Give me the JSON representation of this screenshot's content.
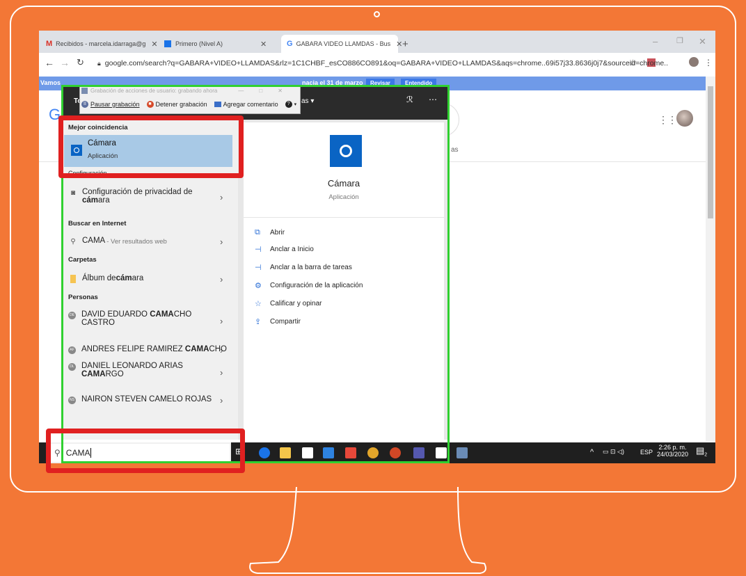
{
  "browser": {
    "tabs": [
      {
        "label": "Recibidos - marcela.idarraga@g",
        "icon": "gmail-icon",
        "color": "#d93025"
      },
      {
        "label": "Primero (Nivel A)",
        "icon": "classroom-icon",
        "color": "#1a73e8"
      },
      {
        "label": "GABARA VIDEO LLAMDAS - Bus",
        "icon": "google-icon",
        "color": "#4285f4"
      }
    ],
    "new_tab": "+",
    "url": "google.com/search?q=GABARA+VIDEO+LLAMDAS&rlz=1C1CHBF_esCO886CO891&oq=GABARA+VIDEO+LLAMDAS&aqs=chrome..69i57j33.8636j0j7&sourceid=chrome...",
    "infobar_left": "Vamos",
    "infobar_mid": "nacia el 31 de marzo",
    "infobar_btn1": "Revisar",
    "infobar_btn2": "Entendido",
    "google_right": "as",
    "google_left_glyph": "G"
  },
  "recorder": {
    "title": "Grabación de acciones de usuario: grabando ahora",
    "pause": "Pausar grabación",
    "stop": "Detener grabación",
    "comment": "Agregar comentario"
  },
  "start_menu": {
    "top_left": "To",
    "top_right": "as ▾",
    "sections": {
      "best_match": "Mejor coincidencia",
      "settings": "Configuración",
      "web": "Buscar en Internet",
      "folders": "Carpetas",
      "people": "Personas"
    },
    "best_match": {
      "name_plain": "Cám",
      "name_bold": "ara",
      "type": "Aplicación"
    },
    "settings_item": {
      "pre": "Configuración de privacidad de",
      "bold": "cám",
      "post": "ara"
    },
    "web_item": {
      "query": "CAMA",
      "suffix": " - Ver resultados web"
    },
    "folder_item": {
      "pre": "Álbum de ",
      "bold": "cám",
      "post": "ara"
    },
    "people": [
      {
        "initials": "DE",
        "pre": "DAVID EDUARDO ",
        "bold": "CAMA",
        "post": "CHO CASTRO"
      },
      {
        "initials": "AF",
        "pre": "ANDRES FELIPE RAMIREZ ",
        "bold": "CAMA",
        "post": "CHO"
      },
      {
        "initials": "DL",
        "pre": "DANIEL LEONARDO ARIAS ",
        "bold": "CAMA",
        "post": "RGO"
      },
      {
        "initials": "NS",
        "pre": "NAIRON STEVEN CAMELO ROJAS",
        "bold": "",
        "post": ""
      }
    ],
    "preview": {
      "name": "Cámara",
      "type": "Aplicación"
    },
    "actions": [
      "Abrir",
      "Anclar a Inicio",
      "Anclar a la barra de tareas",
      "Configuración de la aplicación",
      "Calificar y opinar",
      "Compartir"
    ],
    "search_value": "CAMA"
  },
  "taskbar": {
    "lang": "ESP",
    "time": "2:26 p. m.",
    "date": "24/03/2020",
    "notif": "2"
  },
  "colors": {
    "background": "#f37736",
    "highlight_red": "#e02020",
    "highlight_green": "#30d030",
    "windows_blue": "#0a64c4"
  }
}
